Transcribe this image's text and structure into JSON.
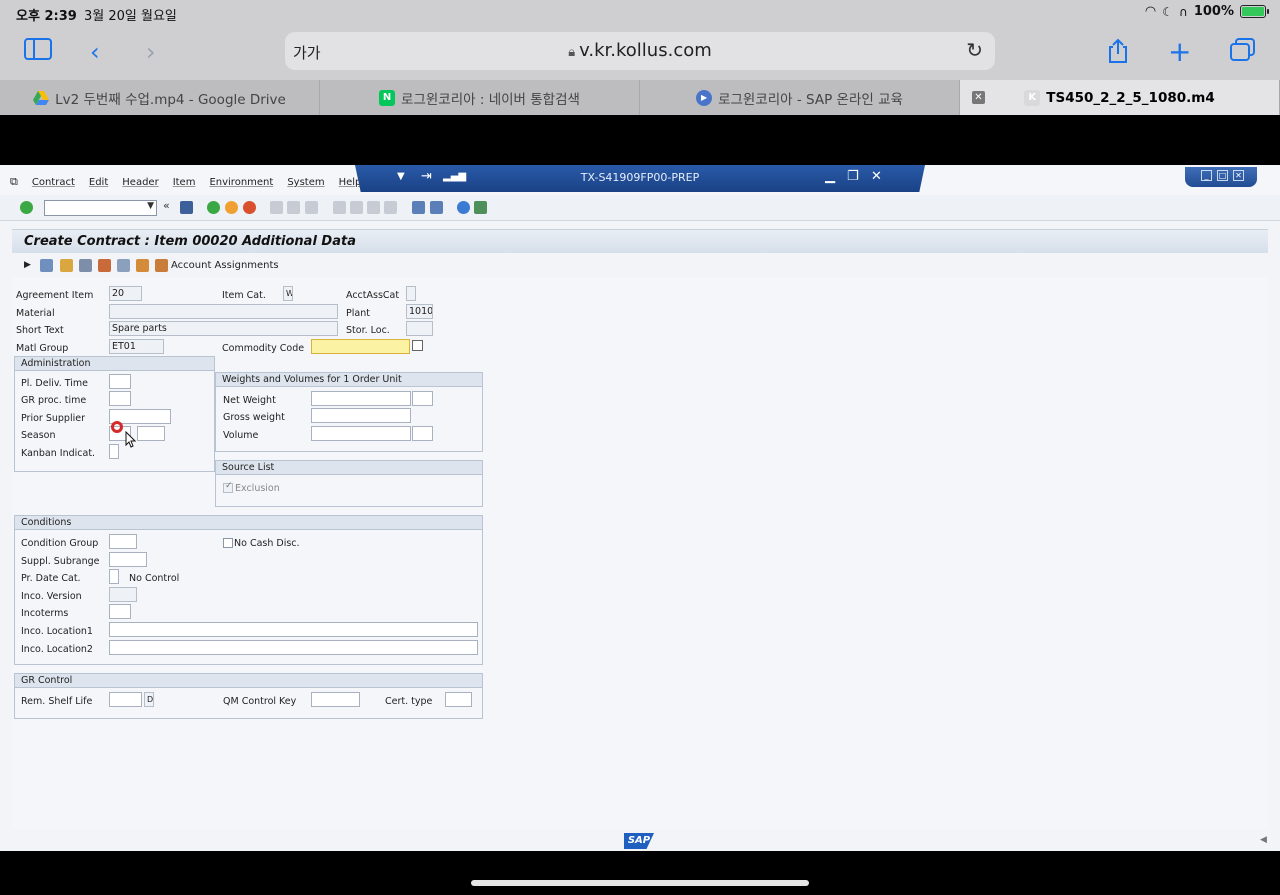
{
  "status": {
    "time": "오후 2:39",
    "date": "3월 20일 월요일",
    "battery": "100%"
  },
  "browser": {
    "text_size": "가가",
    "url": "v.kr.kollus.com",
    "tabs": [
      {
        "label": "Lv2 두번째 수업.mp4 - Google Drive",
        "icon": "google-drive-icon"
      },
      {
        "label": "로그윈코리아 : 네이버 통합검색",
        "icon": "naver-icon",
        "favicon_text": "N"
      },
      {
        "label": "로그윈코리아 - SAP 온라인 교육",
        "icon": "play-icon"
      },
      {
        "label": "TS450_2_2_5_1080.m4",
        "icon": "kollus-icon",
        "favicon_text": "K"
      }
    ]
  },
  "sap": {
    "menu": [
      "Contract",
      "Edit",
      "Header",
      "Item",
      "Environment",
      "System",
      "Help"
    ],
    "window_title": "TX-S41909FP00-PREP",
    "screen_title": "Create Contract : Item 00020 Additional Data",
    "app_toolbar_label": "Account Assignments",
    "header_fields": {
      "agreement_item": {
        "label": "Agreement Item",
        "value": "20"
      },
      "item_cat": {
        "label": "Item Cat.",
        "value": "W"
      },
      "acctasscat": {
        "label": "AcctAssCat",
        "value": ""
      },
      "material": {
        "label": "Material",
        "value": ""
      },
      "plant": {
        "label": "Plant",
        "value": "1010"
      },
      "short_text": {
        "label": "Short Text",
        "value": "Spare parts"
      },
      "stor_loc": {
        "label": "Stor. Loc.",
        "value": ""
      },
      "matl_group": {
        "label": "Matl Group",
        "value": "ET01"
      },
      "commodity_code": {
        "label": "Commodity Code",
        "value": ""
      }
    },
    "administration": {
      "title": "Administration",
      "pl_deliv_time": "Pl. Deliv. Time",
      "gr_proc_time": "GR proc. time",
      "prior_supplier": "Prior Supplier",
      "season": "Season",
      "kanban": "Kanban Indicat."
    },
    "weights": {
      "title": "Weights and Volumes for 1 Order Unit",
      "net_weight": "Net Weight",
      "gross_weight": "Gross weight",
      "volume": "Volume"
    },
    "source_list": {
      "title": "Source List",
      "exclusion": "Exclusion"
    },
    "conditions": {
      "title": "Conditions",
      "condition_group": "Condition Group",
      "no_cash_disc": "No Cash Disc.",
      "suppl_subrange": "Suppl. Subrange",
      "pr_date_cat": "Pr. Date Cat.",
      "no_control": "No Control",
      "inco_version": "Inco. Version",
      "incoterms": "Incoterms",
      "inco_location1": "Inco. Location1",
      "inco_location2": "Inco. Location2"
    },
    "gr_control": {
      "title": "GR Control",
      "rem_shelf_life": "Rem. Shelf Life",
      "rem_shelf_unit": "D",
      "qm_control_key": "QM Control Key",
      "cert_type": "Cert. type"
    },
    "logo": "SAP"
  }
}
